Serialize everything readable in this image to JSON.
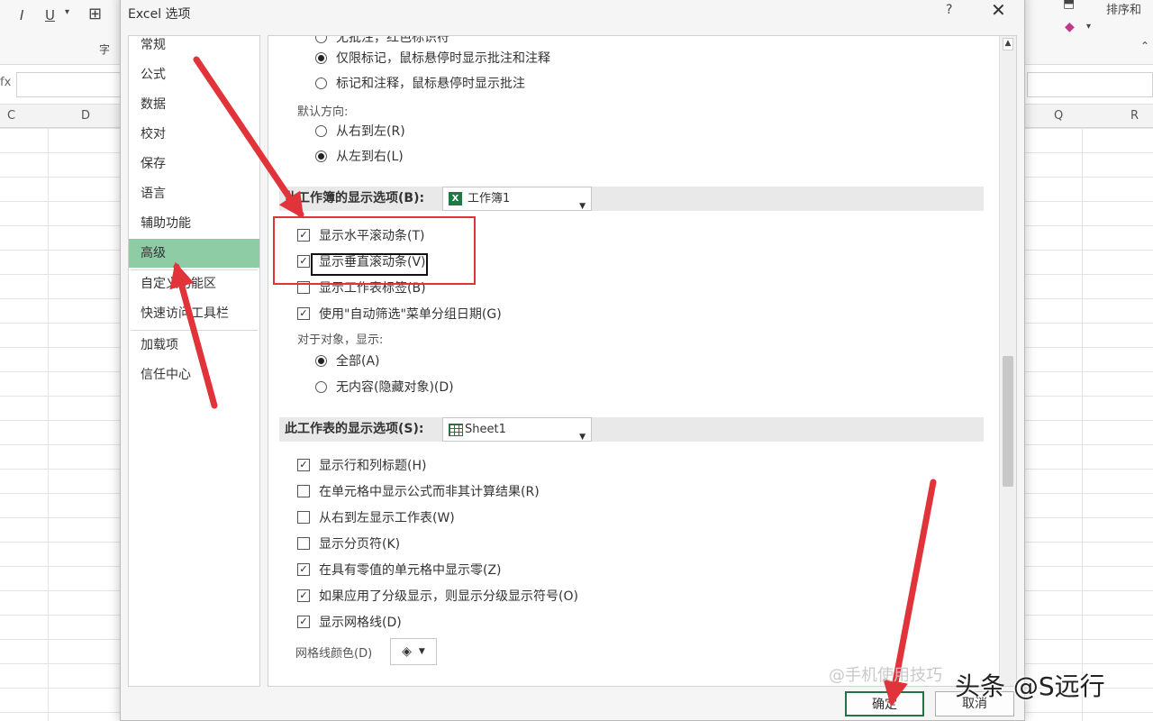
{
  "window": {
    "title": "Excel 选项",
    "help_label": "?",
    "close_label": "✕"
  },
  "ribbon": {
    "italic_label": "I",
    "underline_label": "U",
    "font_group_label": "字",
    "right_label": "排序和",
    "eraser_icon": "eraser-icon"
  },
  "columns": [
    "C",
    "D",
    "Q",
    "R"
  ],
  "nav": {
    "items": [
      {
        "label": "常规"
      },
      {
        "label": "公式"
      },
      {
        "label": "数据"
      },
      {
        "label": "校对"
      },
      {
        "label": "保存"
      },
      {
        "label": "语言"
      },
      {
        "label": "辅助功能"
      },
      {
        "label": "高级",
        "active": true
      },
      {
        "label": "自定义功能区"
      },
      {
        "label": "快速访问工具栏"
      },
      {
        "label": "加载项"
      },
      {
        "label": "信任中心"
      }
    ]
  },
  "content": {
    "comments": {
      "option_partial": "无批注，红色标识符",
      "option_indicator": "仅限标记，鼠标悬停时显示批注和注释",
      "option_all": "标记和注释，鼠标悬停时显示批注"
    },
    "direction": {
      "label": "默认方向:",
      "rtl": "从右到左(R)",
      "ltr": "从左到右(L)"
    },
    "workbook_section": {
      "title": "此工作簿的显示选项(B):",
      "dropdown_value": "工作簿1",
      "options": [
        {
          "label": "显示水平滚动条(T)",
          "checked": true
        },
        {
          "label": "显示垂直滚动条(V)",
          "checked": true
        },
        {
          "label": "显示工作表标签(B)",
          "checked": false
        },
        {
          "label": "使用\"自动筛选\"菜单分组日期(G)",
          "checked": true
        }
      ],
      "objects_label": "对于对象，显示:",
      "objects_all": "全部(A)",
      "objects_none": "无内容(隐藏对象)(D)"
    },
    "sheet_section": {
      "title": "此工作表的显示选项(S):",
      "dropdown_value": "Sheet1",
      "options": [
        {
          "label": "显示行和列标题(H)",
          "checked": true
        },
        {
          "label": "在单元格中显示公式而非其计算结果(R)",
          "checked": false
        },
        {
          "label": "从右到左显示工作表(W)",
          "checked": false
        },
        {
          "label": "显示分页符(K)",
          "checked": false
        },
        {
          "label": "在具有零值的单元格中显示零(Z)",
          "checked": true
        },
        {
          "label": "如果应用了分级显示，则显示分级显示符号(O)",
          "checked": true
        },
        {
          "label": "显示网格线(D)",
          "checked": true
        }
      ],
      "gridline_color_label": "网格线颜色(D)"
    }
  },
  "buttons": {
    "ok": "确定",
    "cancel": "取消"
  },
  "watermark": {
    "main": "头条 @S远行",
    "faint": "@手机使用技巧"
  },
  "colors": {
    "accent_green": "#8ecca6",
    "annotation_red": "#e0343a",
    "excel_green": "#217346"
  }
}
